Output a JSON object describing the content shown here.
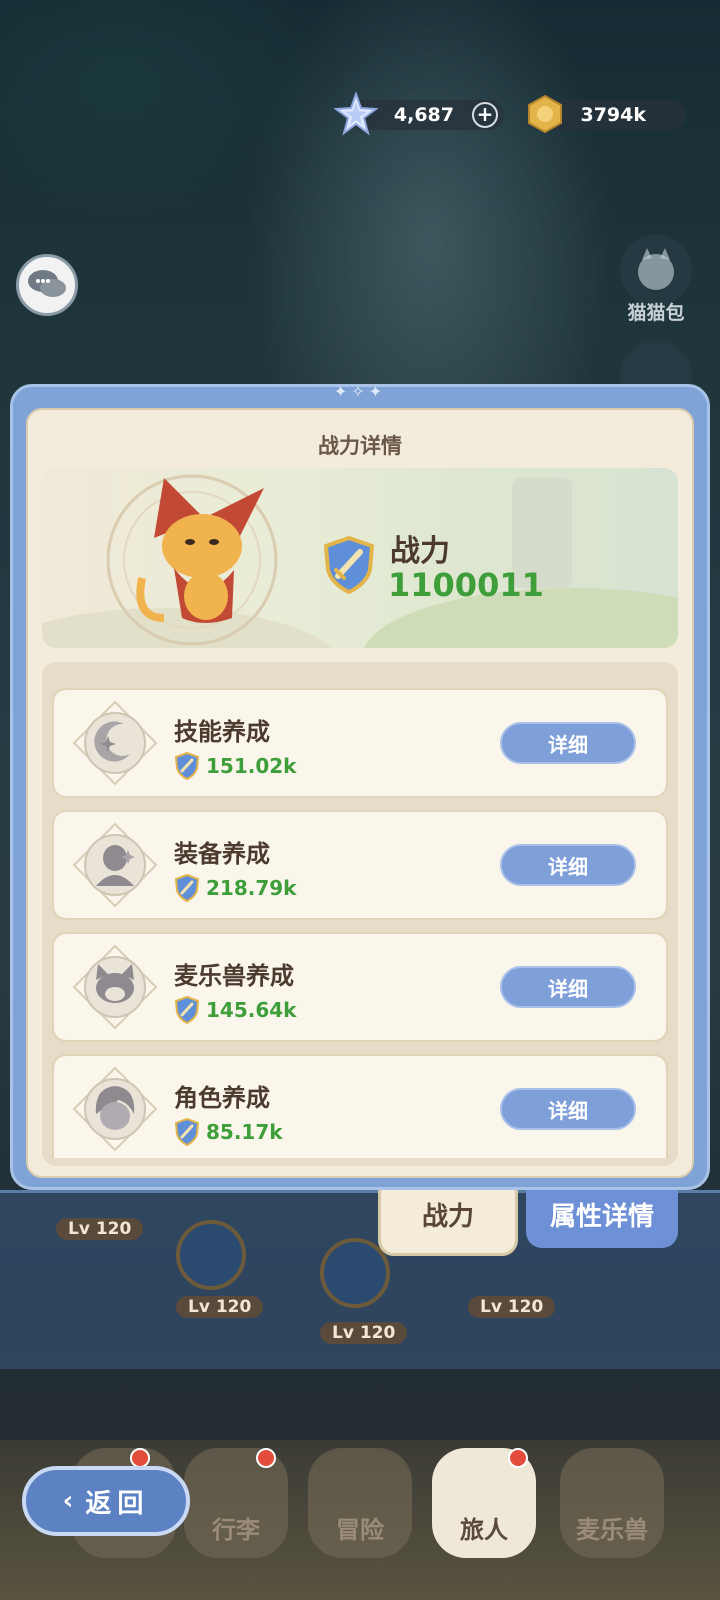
{
  "currency": {
    "gems": "4,687",
    "gold": "3794k"
  },
  "side": {
    "cat_bag_label": "猫猫包"
  },
  "popup": {
    "title": "战力详情",
    "power_label": "战力",
    "power_value": "1100011",
    "items": [
      {
        "title": "技能养成",
        "value": "151.02k",
        "button": "详细",
        "icon": "moon-sparkle-icon"
      },
      {
        "title": "装备养成",
        "value": "218.79k",
        "button": "详细",
        "icon": "armor-person-icon"
      },
      {
        "title": "麦乐兽养成",
        "value": "145.64k",
        "button": "详细",
        "icon": "cat-face-icon"
      },
      {
        "title": "角色养成",
        "value": "85.17k",
        "button": "详细",
        "icon": "character-head-icon"
      }
    ]
  },
  "tabs": {
    "power": "战力",
    "attributes": "属性详情"
  },
  "background_levels": {
    "lv1": "Lv 120",
    "lv2": "Lv 120",
    "lv3": "Lv 120",
    "lv4": "Lv 120"
  },
  "nav": {
    "back": "返回",
    "items": [
      {
        "label": "行李"
      },
      {
        "label": "冒险"
      },
      {
        "label": "旅人"
      },
      {
        "label": "麦乐兽"
      }
    ]
  },
  "colors": {
    "accent_blue": "#7f9fd8",
    "power_green": "#3e9e3a",
    "panel_cream": "#f3ebdb"
  }
}
